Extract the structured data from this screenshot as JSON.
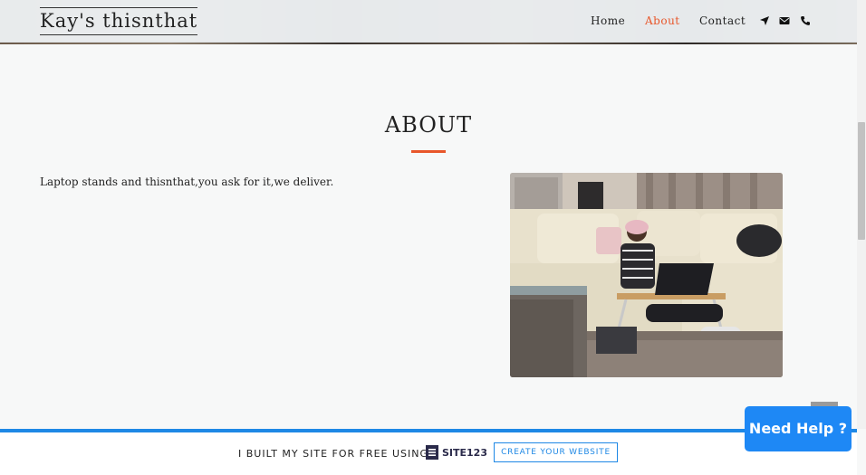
{
  "header": {
    "logo": "Kay's thisnthat",
    "nav": [
      {
        "label": "Home",
        "active": false
      },
      {
        "label": "About",
        "active": true
      },
      {
        "label": "Contact",
        "active": false
      }
    ],
    "icons": [
      "location-arrow-icon",
      "envelope-icon",
      "phone-icon"
    ],
    "accent_color": "#e8562a"
  },
  "about": {
    "title": "ABOUT",
    "text": "Laptop stands and thisnthat,you ask for it,we deliver."
  },
  "footer": {
    "built_text": "I BUILT MY SITE FOR FREE USING",
    "brand": "SITE123",
    "cta": "CREATE YOUR WEBSITE",
    "border_color": "#1e88e5"
  },
  "help": {
    "label": "Need Help ?"
  }
}
